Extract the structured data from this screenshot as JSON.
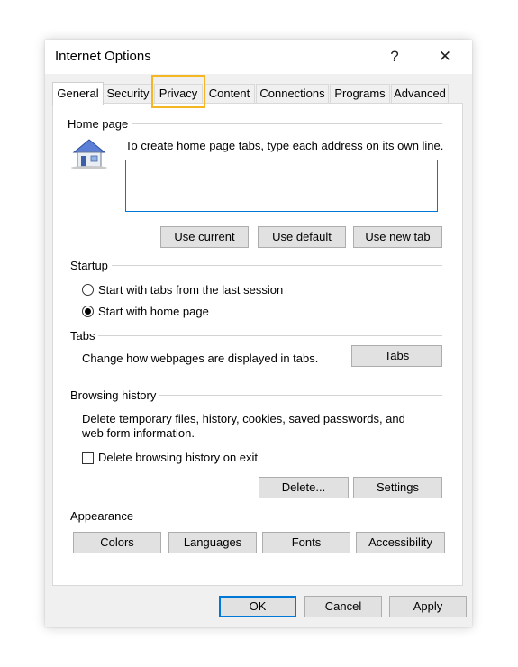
{
  "window": {
    "title": "Internet Options",
    "help": "?",
    "close": "✕"
  },
  "tabs": [
    "General",
    "Security",
    "Privacy",
    "Content",
    "Connections",
    "Programs",
    "Advanced"
  ],
  "home_page": {
    "label": "Home page",
    "description": "To create home page tabs, type each address on its own line.",
    "textarea_value": "",
    "buttons": {
      "use_current": "Use current",
      "use_default": "Use default",
      "use_new_tab": "Use new tab"
    }
  },
  "startup": {
    "label": "Startup",
    "options": [
      "Start with tabs from the last session",
      "Start with home page"
    ],
    "selected": "Start with home page"
  },
  "tabs_section": {
    "label": "Tabs",
    "description": "Change how webpages are displayed in tabs.",
    "button": "Tabs"
  },
  "browsing_history": {
    "label": "Browsing history",
    "description_line1": "Delete temporary files, history, cookies, saved passwords, and",
    "description_line2": "web form information.",
    "checkbox_label": "Delete browsing history on exit",
    "checkbox_checked": false,
    "buttons": {
      "delete": "Delete...",
      "settings": "Settings"
    }
  },
  "appearance": {
    "label": "Appearance",
    "buttons": {
      "colors": "Colors",
      "languages": "Languages",
      "fonts": "Fonts",
      "accessibility": "Accessibility"
    }
  },
  "footer": {
    "ok": "OK",
    "cancel": "Cancel",
    "apply": "Apply"
  },
  "colors": {
    "highlight": "#f5b623",
    "focus": "#0078d7"
  }
}
